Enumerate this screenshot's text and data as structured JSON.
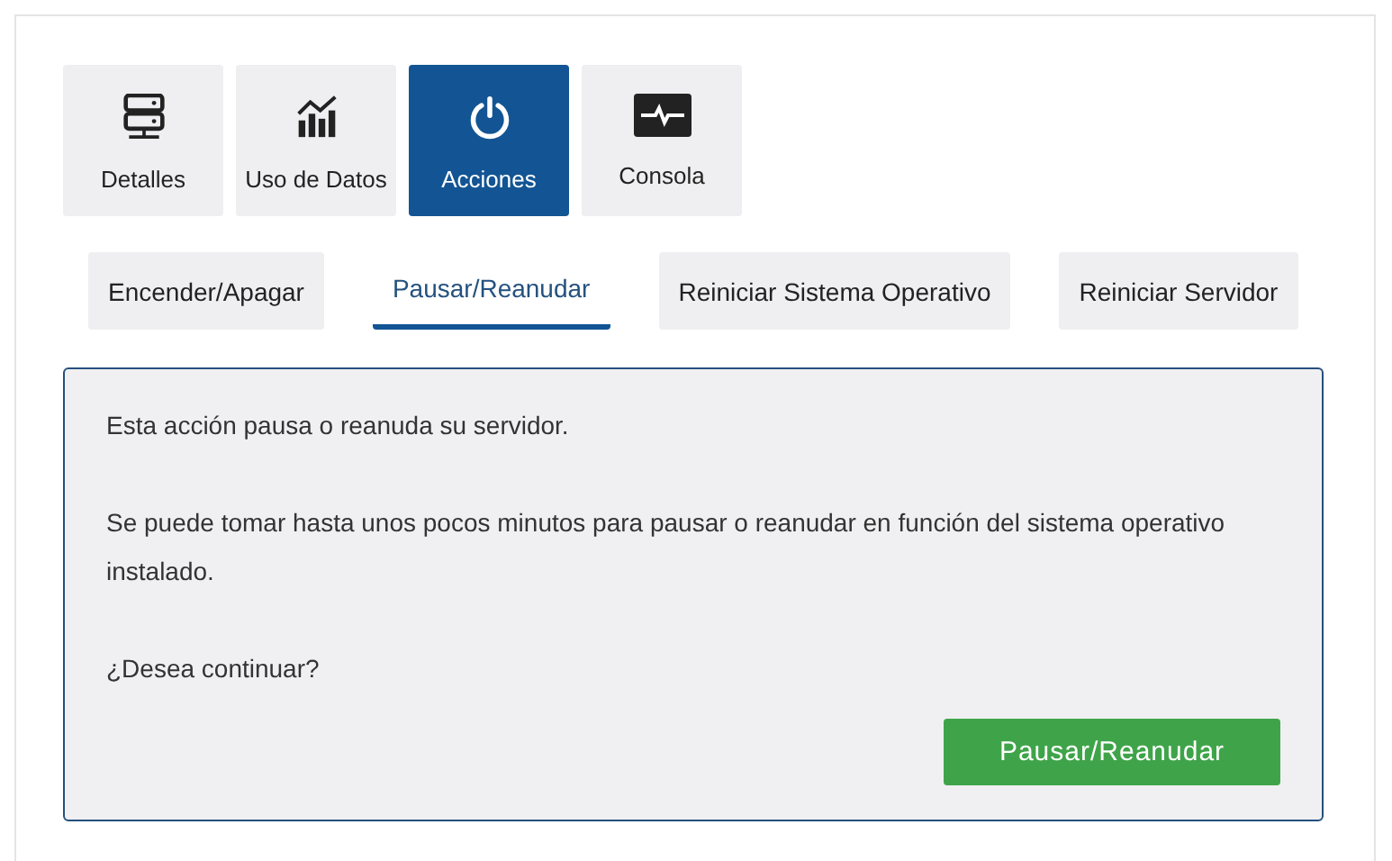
{
  "tiles": [
    {
      "label": "Detalles",
      "kind": "server",
      "selected": false
    },
    {
      "label": "Uso de Datos",
      "kind": "chart",
      "selected": false
    },
    {
      "label": "Acciones",
      "kind": "power",
      "selected": true
    },
    {
      "label": "Consola",
      "kind": "monitor",
      "selected": false
    }
  ],
  "subtabs": [
    {
      "label": "Encender/Apagar",
      "selected": false
    },
    {
      "label": "Pausar/Reanudar",
      "selected": true
    },
    {
      "label": "Reiniciar Sistema Operativo",
      "selected": false
    },
    {
      "label": "Reiniciar Servidor",
      "selected": false
    }
  ],
  "panel": {
    "paragraphs": [
      "Esta acción pausa o reanuda su servidor.",
      "Se puede tomar hasta unos pocos minutos para pausar o reanudar en función del sistema operativo instalado.",
      "¿Desea continuar?"
    ],
    "button": "Pausar/Reanudar"
  }
}
